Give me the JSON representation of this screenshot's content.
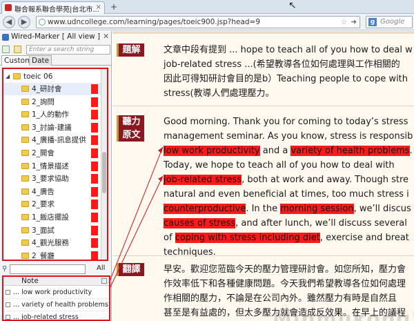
{
  "browser": {
    "tab_title": "聯合報系聯合學苑|台北市...",
    "tab_close": "×",
    "new_tab": "+",
    "url": "www.udncollege.com/learning/pages/toeic900.jsp?head=9",
    "search_engine": "Google"
  },
  "sidebar": {
    "title": "Wired-Marker [ All view ]",
    "search_placeholder": "Enter a search string",
    "tabs": [
      "Custom",
      "Date"
    ],
    "root_folder": "toeic 06",
    "folders": [
      "4_研討會",
      "2_詢問",
      "1_人的動作",
      "3_討論-建議",
      "4_廣播-訊息提供",
      "2_開會",
      "1_情景描述",
      "3_要求協助",
      "4_廣告",
      "2_要求",
      "1_飯店擺設",
      "3_面試",
      "4_觀光服務",
      "2_餐廳"
    ],
    "filter_select": "All",
    "notes_header": "Note",
    "notes": [
      "... low work productivity",
      "... variety of health problems",
      "... job-related stress"
    ]
  },
  "main": {
    "sections": [
      {
        "label": [
          "題解"
        ],
        "lines": [
          "文章中段有提到 ... hope to teach all of you how to deal w",
          "job-related stress ...(希望教導各位如何處理與工作相關的",
          "因此可得知研討會目的是b）Teaching people to cope with",
          "stress(教導人們處理壓力。"
        ]
      },
      {
        "label": [
          "聽力",
          "原文"
        ],
        "lines": [
          [
            {
              "t": "Good morning. Thank you for coming to today’s stress"
            }
          ],
          [
            {
              "t": "management seminar. As you know, stress is responsib"
            }
          ],
          [
            {
              "t": "low work productivity",
              "h": true
            },
            {
              "t": " and a "
            },
            {
              "t": "variety of health problems",
              "h": true
            },
            {
              "t": "."
            }
          ],
          [
            {
              "t": "Today, we hope to teach all of you how to deal with"
            }
          ],
          [
            {
              "t": "job-related stress",
              "h": true
            },
            {
              "t": ", both at work and away. Though stre"
            }
          ],
          [
            {
              "t": "natural and even beneficial at times, too much stress i"
            }
          ],
          [
            {
              "t": "counterproductive",
              "h": true
            },
            {
              "t": ". In the "
            },
            {
              "t": "morning session",
              "h": true
            },
            {
              "t": ", we’ll discus"
            }
          ],
          [
            {
              "t": "causes of stress",
              "h": true
            },
            {
              "t": ", and after lunch, we’ll discuss several"
            }
          ],
          [
            {
              "t": "of "
            },
            {
              "t": "coping with stress including diet",
              "h": true
            },
            {
              "t": ", exercise and breat"
            }
          ],
          [
            {
              "t": "techniques."
            }
          ]
        ]
      },
      {
        "label": [
          "翻譯"
        ],
        "lines": [
          "早安。歡迎您蒞臨今天的壓力管理研討會。如您所知，壓力會",
          "作效率低下和各種健康問題。今天我們希望教導各位如何處理",
          "作相關的壓力，不論是在公司內外。雖然壓力有時是自然且",
          "甚至是有益處的，但太多壓力就會造成反效果。在早上的議程"
        ]
      }
    ],
    "watermark": "Minmukong's"
  },
  "colors": {
    "highlight": "#ff1a1a",
    "label_bg": "#8a1820",
    "page_bg": "#fff9f0"
  }
}
